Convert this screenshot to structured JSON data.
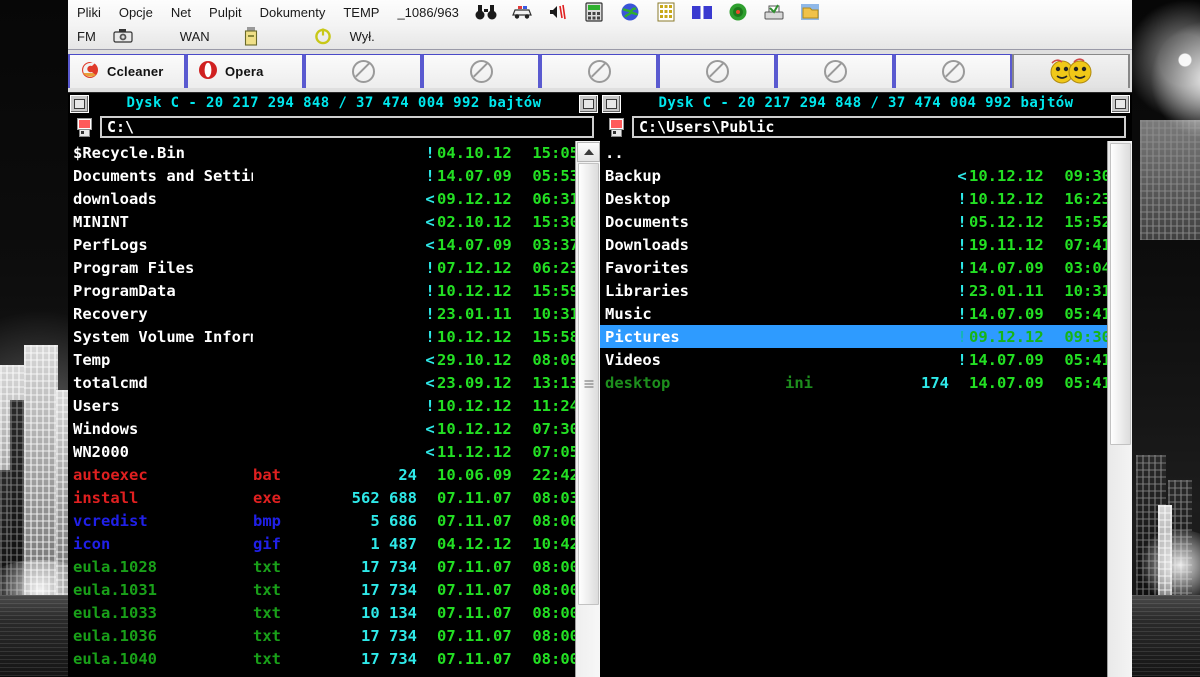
{
  "menu": {
    "row1": [
      {
        "label": "Pliki",
        "name": "menu-pliki"
      },
      {
        "label": "Opcje",
        "name": "menu-opcje"
      },
      {
        "label": "Net",
        "name": "menu-net"
      },
      {
        "label": "Pulpit",
        "name": "menu-pulpit"
      },
      {
        "label": "Dokumenty",
        "name": "menu-dokumenty"
      },
      {
        "label": "TEMP",
        "name": "menu-temp"
      },
      {
        "label": "_1086/963",
        "name": "menu-counter"
      }
    ],
    "row1_icons": [
      {
        "name": "binoculars-icon",
        "glyph": "binoculars"
      },
      {
        "name": "car-icon",
        "glyph": "car"
      },
      {
        "name": "speaker-mute-icon",
        "glyph": "speaker"
      },
      {
        "name": "calculator-icon",
        "glyph": "calculator"
      },
      {
        "name": "globe-icon",
        "glyph": "globe"
      },
      {
        "name": "grid-icon",
        "glyph": "grid"
      },
      {
        "name": "book-icon",
        "glyph": "book"
      },
      {
        "name": "cd-icon",
        "glyph": "cd"
      },
      {
        "name": "printer-icon",
        "glyph": "printer"
      },
      {
        "name": "folder-icon",
        "glyph": "folder"
      }
    ],
    "row2": [
      {
        "label": "FM",
        "name": "menu-fm"
      },
      {
        "label": "WAN",
        "name": "menu-wan"
      },
      {
        "label": "Wył.",
        "name": "menu-wyl"
      }
    ],
    "row2_icons": [
      {
        "name": "camera-icon",
        "glyph": "camera"
      },
      {
        "name": "usb-drive-icon",
        "glyph": "usb"
      },
      {
        "name": "power-icon",
        "glyph": "power"
      }
    ]
  },
  "tabs": [
    {
      "label": "Ccleaner",
      "icon": "ccleaner-icon",
      "type": "named"
    },
    {
      "label": "Opera",
      "icon": "opera-icon",
      "type": "named"
    },
    {
      "label": "",
      "icon": "no-entry-icon",
      "type": "empty"
    },
    {
      "label": "",
      "icon": "no-entry-icon",
      "type": "empty"
    },
    {
      "label": "",
      "icon": "no-entry-icon",
      "type": "empty"
    },
    {
      "label": "",
      "icon": "no-entry-icon",
      "type": "empty"
    },
    {
      "label": "",
      "icon": "no-entry-icon",
      "type": "empty"
    },
    {
      "label": "",
      "icon": "no-entry-icon",
      "type": "empty"
    },
    {
      "label": "",
      "icon": "smiley-icon",
      "type": "smiley"
    }
  ],
  "left_pane": {
    "title": "Dysk C - 20 217 294 848 / 37 474 004 992 bajtów",
    "path": "C:\\",
    "rows": [
      {
        "name": "$Recycle.Bin",
        "ext": "",
        "size": "",
        "mark": "!",
        "date": "04.10.12",
        "time": "15:05",
        "color": "white"
      },
      {
        "name": "Documents and Settings",
        "ext": "",
        "size": "",
        "mark": "!",
        "date": "14.07.09",
        "time": "05:53",
        "color": "white"
      },
      {
        "name": "downloads",
        "ext": "",
        "size": "",
        "mark": "<",
        "date": "09.12.12",
        "time": "06:31",
        "color": "white"
      },
      {
        "name": "MININT",
        "ext": "",
        "size": "",
        "mark": "<",
        "date": "02.10.12",
        "time": "15:30",
        "color": "white"
      },
      {
        "name": "PerfLogs",
        "ext": "",
        "size": "",
        "mark": "<",
        "date": "14.07.09",
        "time": "03:37",
        "color": "white"
      },
      {
        "name": "Program Files",
        "ext": "",
        "size": "",
        "mark": "!",
        "date": "07.12.12",
        "time": "06:23",
        "color": "white"
      },
      {
        "name": "ProgramData",
        "ext": "",
        "size": "",
        "mark": "!",
        "date": "10.12.12",
        "time": "15:59",
        "color": "white"
      },
      {
        "name": "Recovery",
        "ext": "",
        "size": "",
        "mark": "!",
        "date": "23.01.11",
        "time": "10:31",
        "color": "white"
      },
      {
        "name": "System Volume Information",
        "ext": "",
        "size": "",
        "mark": "!",
        "date": "10.12.12",
        "time": "15:58",
        "color": "white"
      },
      {
        "name": "Temp",
        "ext": "",
        "size": "",
        "mark": "<",
        "date": "29.10.12",
        "time": "08:09",
        "color": "white"
      },
      {
        "name": "totalcmd",
        "ext": "",
        "size": "",
        "mark": "<",
        "date": "23.09.12",
        "time": "13:13",
        "color": "white"
      },
      {
        "name": "Users",
        "ext": "",
        "size": "",
        "mark": "!",
        "date": "10.12.12",
        "time": "11:24",
        "color": "white"
      },
      {
        "name": "Windows",
        "ext": "",
        "size": "",
        "mark": "<",
        "date": "10.12.12",
        "time": "07:30",
        "color": "white"
      },
      {
        "name": "WN2000",
        "ext": "",
        "size": "",
        "mark": "<",
        "date": "11.12.12",
        "time": "07:05",
        "color": "white"
      },
      {
        "name": "autoexec",
        "ext": "bat",
        "size": "24",
        "mark": "",
        "date": "10.06.09",
        "time": "22:42",
        "color": "red"
      },
      {
        "name": "install",
        "ext": "exe",
        "size": "562 688",
        "mark": "",
        "date": "07.11.07",
        "time": "08:03",
        "color": "red"
      },
      {
        "name": "vcredist",
        "ext": "bmp",
        "size": "5 686",
        "mark": "",
        "date": "07.11.07",
        "time": "08:00",
        "color": "blue"
      },
      {
        "name": "icon",
        "ext": "gif",
        "size": "1 487",
        "mark": "",
        "date": "04.12.12",
        "time": "10:42",
        "color": "blue"
      },
      {
        "name": "eula.1028",
        "ext": "txt",
        "size": "17 734",
        "mark": "",
        "date": "07.11.07",
        "time": "08:00",
        "color": "green"
      },
      {
        "name": "eula.1031",
        "ext": "txt",
        "size": "17 734",
        "mark": "",
        "date": "07.11.07",
        "time": "08:00",
        "color": "green"
      },
      {
        "name": "eula.1033",
        "ext": "txt",
        "size": "10 134",
        "mark": "",
        "date": "07.11.07",
        "time": "08:00",
        "color": "green"
      },
      {
        "name": "eula.1036",
        "ext": "txt",
        "size": "17 734",
        "mark": "",
        "date": "07.11.07",
        "time": "08:00",
        "color": "green"
      },
      {
        "name": "eula.1040",
        "ext": "txt",
        "size": "17 734",
        "mark": "",
        "date": "07.11.07",
        "time": "08:00",
        "color": "green"
      }
    ]
  },
  "right_pane": {
    "title": "Dysk C - 20 217 294 848 / 37 474 004 992 bajtów",
    "path": "C:\\Users\\Public",
    "rows": [
      {
        "name": "..",
        "ext": "",
        "size": "",
        "mark": "",
        "date": "",
        "time": "",
        "color": "white"
      },
      {
        "name": "Backup",
        "ext": "",
        "size": "",
        "mark": "<",
        "date": "10.12.12",
        "time": "09:30",
        "color": "white"
      },
      {
        "name": "Desktop",
        "ext": "",
        "size": "",
        "mark": "!",
        "date": "10.12.12",
        "time": "16:23",
        "color": "white"
      },
      {
        "name": "Documents",
        "ext": "",
        "size": "",
        "mark": "!",
        "date": "05.12.12",
        "time": "15:52",
        "color": "white"
      },
      {
        "name": "Downloads",
        "ext": "",
        "size": "",
        "mark": "!",
        "date": "19.11.12",
        "time": "07:41",
        "color": "white"
      },
      {
        "name": "Favorites",
        "ext": "",
        "size": "",
        "mark": "!",
        "date": "14.07.09",
        "time": "03:04",
        "color": "white"
      },
      {
        "name": "Libraries",
        "ext": "",
        "size": "",
        "mark": "!",
        "date": "23.01.11",
        "time": "10:31",
        "color": "white"
      },
      {
        "name": "Music",
        "ext": "",
        "size": "",
        "mark": "!",
        "date": "14.07.09",
        "time": "05:41",
        "color": "white"
      },
      {
        "name": "Pictures",
        "ext": "",
        "size": "",
        "mark": "!",
        "date": "09.12.12",
        "time": "09:30",
        "color": "white",
        "selected": true
      },
      {
        "name": "Videos",
        "ext": "",
        "size": "",
        "mark": "!",
        "date": "14.07.09",
        "time": "05:41",
        "color": "white"
      },
      {
        "name": "desktop",
        "ext": "ini",
        "size": "174",
        "mark": "",
        "date": "14.07.09",
        "time": "05:41",
        "color": "dgreen"
      }
    ]
  },
  "colors": {
    "panel_bg": "#000000",
    "title_cyan": "#00e8ee",
    "date_green": "#23e023",
    "size_cyan": "#2ee8e8",
    "selection_blue": "#2e9bff",
    "tab_border": "#5a5ad0"
  }
}
